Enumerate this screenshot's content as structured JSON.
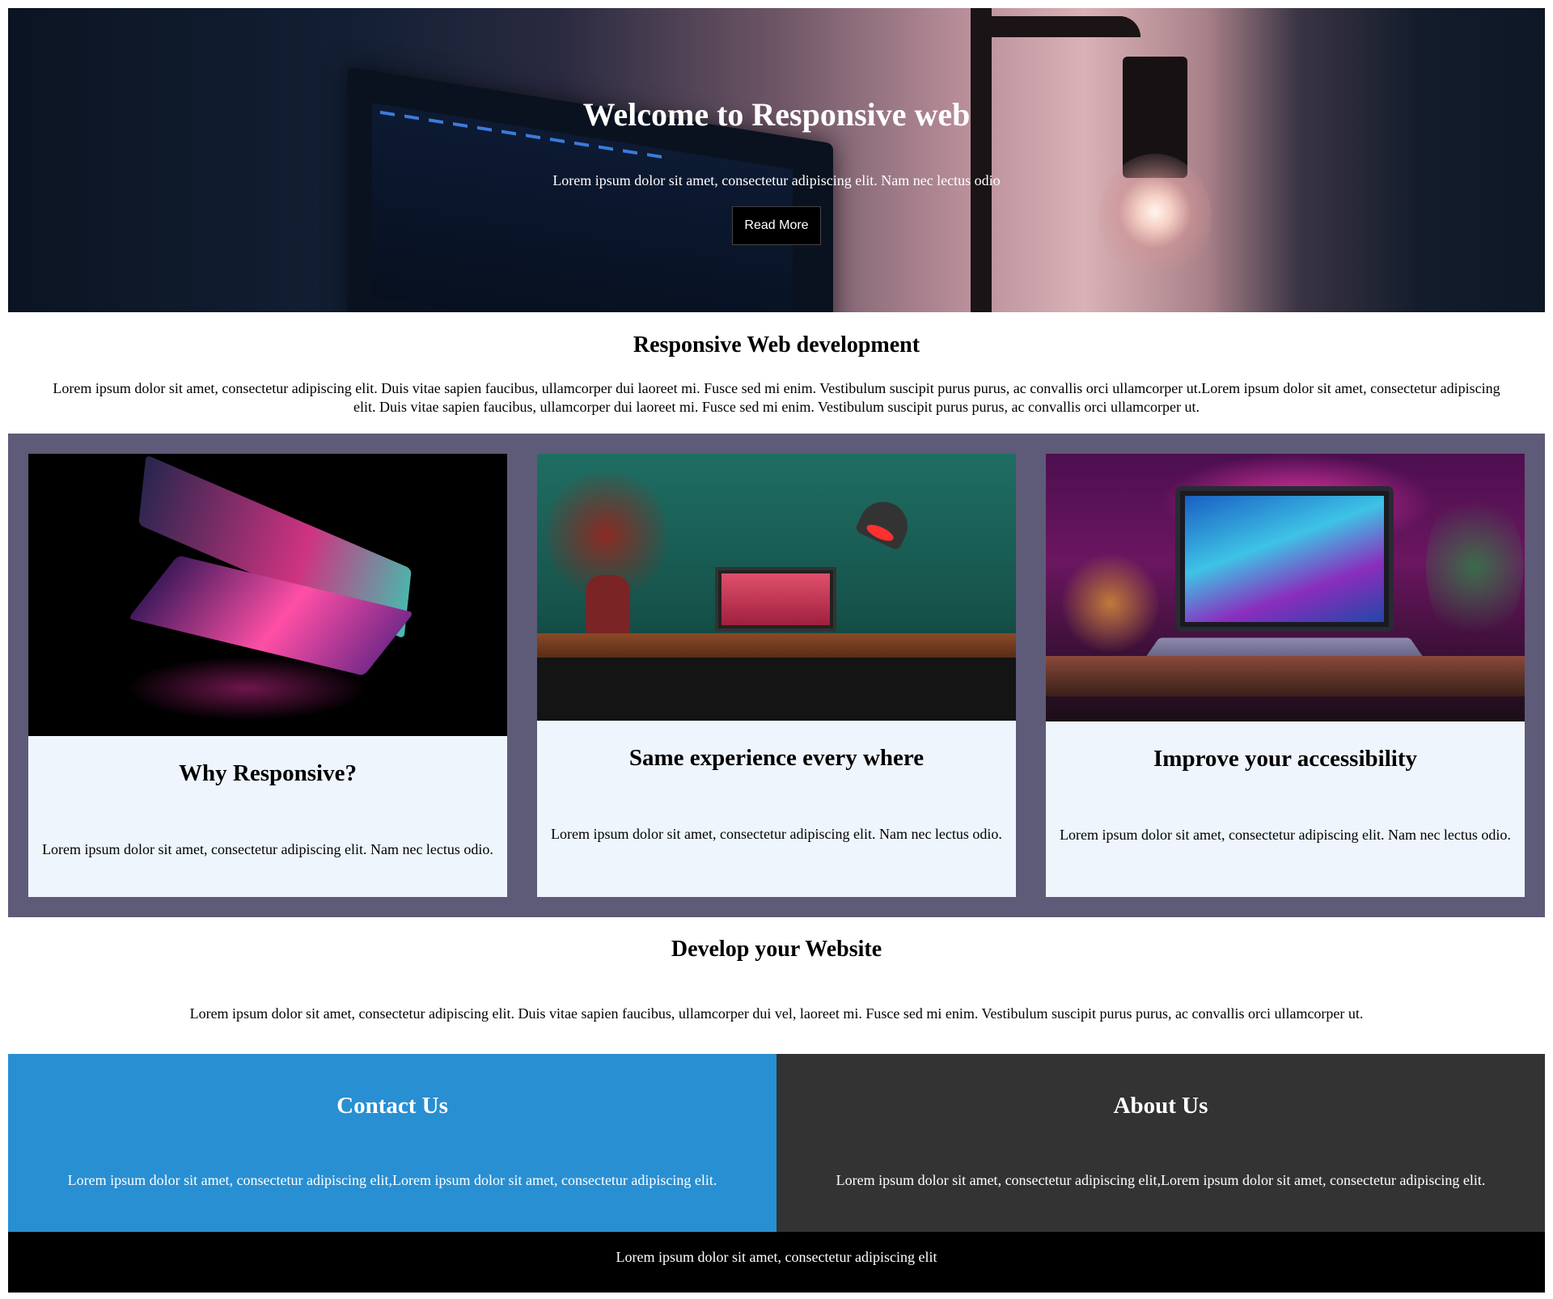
{
  "hero": {
    "title": "Welcome to Responsive web",
    "subtitle": "Lorem ipsum dolor sit amet, consectetur adipiscing elit. Nam nec lectus odio",
    "button_label": "Read More"
  },
  "intro": {
    "title": "Responsive Web development",
    "text": "Lorem ipsum dolor sit amet, consectetur adipiscing elit. Duis vitae sapien faucibus, ullamcorper dui laoreet mi. Fusce sed mi enim. Vestibulum suscipit purus purus, ac convallis orci ullamcorper ut.Lorem ipsum dolor sit amet, consectetur adipiscing elit. Duis vitae sapien faucibus, ullamcorper dui laoreet mi. Fusce sed mi enim. Vestibulum suscipit purus purus, ac convallis orci ullamcorper ut."
  },
  "cards": [
    {
      "title": "Why Responsive?",
      "text": "Lorem ipsum dolor sit amet, consectetur adipiscing elit. Nam nec lectus odio."
    },
    {
      "title": "Same experience every where",
      "text": "Lorem ipsum dolor sit amet, consectetur adipiscing elit. Nam nec lectus odio."
    },
    {
      "title": "Improve your accessibility",
      "text": "Lorem ipsum dolor sit amet, consectetur adipiscing elit. Nam nec lectus odio."
    }
  ],
  "develop": {
    "title": "Develop your Website",
    "text": "Lorem ipsum dolor sit amet, consectetur adipiscing elit. Duis vitae sapien faucibus, ullamcorper dui vel, laoreet mi. Fusce sed mi enim. Vestibulum suscipit purus purus, ac convallis orci ullamcorper ut."
  },
  "contact": {
    "title": "Contact Us",
    "text": "Lorem ipsum dolor sit amet, consectetur adipiscing elit,Lorem ipsum dolor sit amet, consectetur adipiscing elit."
  },
  "about": {
    "title": "About Us",
    "text": "Lorem ipsum dolor sit amet, consectetur adipiscing elit,Lorem ipsum dolor sit amet, consectetur adipiscing elit."
  },
  "footer": {
    "text": "Lorem ipsum dolor sit amet, consectetur adipiscing elit"
  },
  "colors": {
    "cards_background": "#5e5b78",
    "card_background": "#eef5fc",
    "contact_background": "#288fd3",
    "about_background": "#333333",
    "footer_background": "#000000"
  }
}
